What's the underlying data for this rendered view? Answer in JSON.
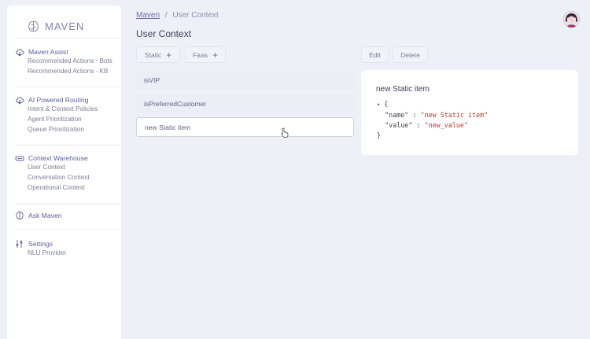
{
  "app": {
    "logo_text": "MAVEN"
  },
  "sidebar": {
    "sections": [
      {
        "title": "Maven Assist",
        "icon": "cloud-icon",
        "items": [
          "Recommended Actions - Bots",
          "Recommended Actions - KB"
        ]
      },
      {
        "title": "AI Powered Routing",
        "icon": "cloud-icon",
        "items": [
          "Intent & Context Policies",
          "Agent Prioritization",
          "Queue Prioritization"
        ]
      },
      {
        "title": "Context Warehouse",
        "icon": "database-icon",
        "items": [
          "User Context",
          "Conversation Context",
          "Operational Context"
        ]
      },
      {
        "title": "Ask Maven",
        "icon": "brain-icon",
        "items": []
      },
      {
        "title": "Settings",
        "icon": "settings-sliders-icon",
        "items": [
          "NLU Provider"
        ]
      }
    ]
  },
  "breadcrumb": {
    "parent": "Maven",
    "separator": "/",
    "current": "User Context"
  },
  "page": {
    "title": "User Context"
  },
  "toolbar": {
    "static_label": "Static",
    "faas_label": "Faas",
    "edit_label": "Edit",
    "delete_label": "Delete"
  },
  "list": {
    "items": [
      "isVIP",
      "isPreferredCustomer",
      "new Static item"
    ],
    "active_index": 2
  },
  "detail": {
    "title": "new Static item",
    "json": {
      "open_brace": "{",
      "close_brace": "}",
      "pairs": [
        {
          "key": "\"name\"",
          "value": "\"new Static item\""
        },
        {
          "key": "\"value\"",
          "value": "\"new_value\""
        }
      ]
    }
  }
}
